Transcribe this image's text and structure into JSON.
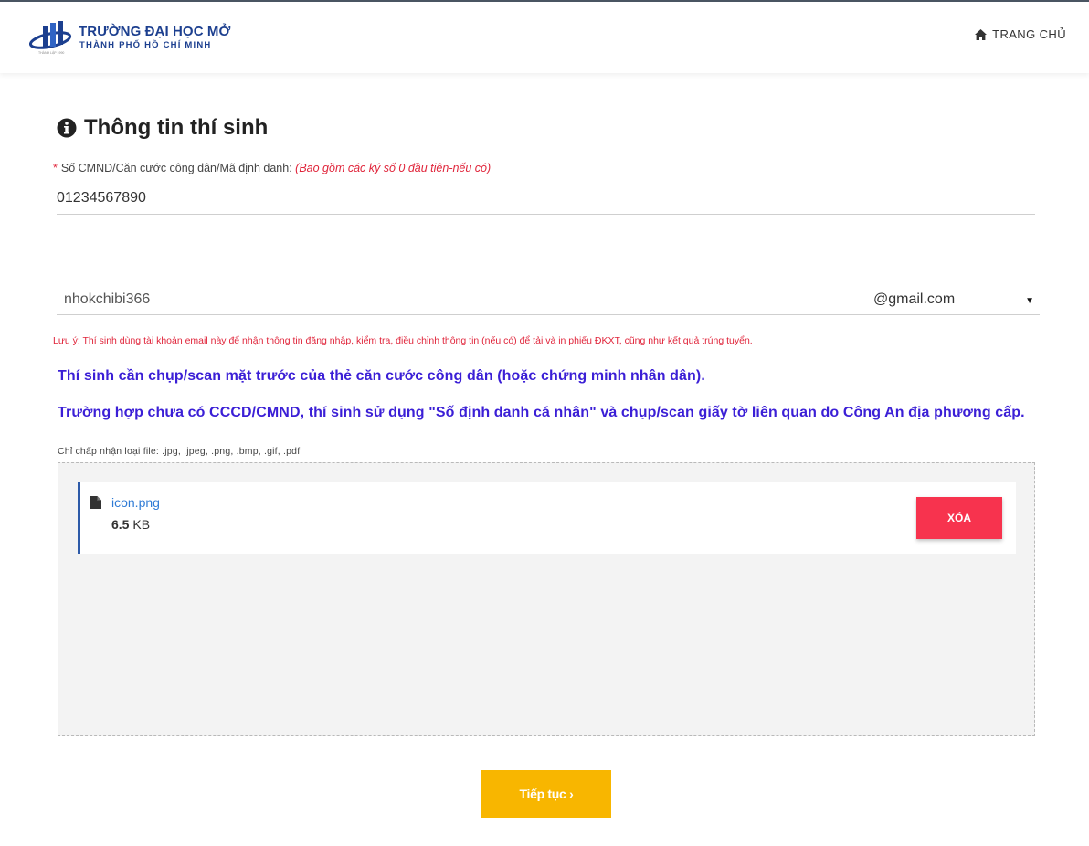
{
  "header": {
    "logo_line1": "TRƯỜNG ĐẠI HỌC MỞ",
    "logo_line2": "THÀNH PHỐ HỒ CHÍ MINH",
    "logo_small": "THÀNH LẬP 1990",
    "nav_home": "TRANG CHỦ"
  },
  "form": {
    "title": "Thông tin thí sinh",
    "id_label": {
      "required_mark": "*",
      "text": "Số CMND/Căn cước công dân/Mã định danh:",
      "hint": "(Bao gồm các ký số 0 đầu tiên-nếu có)"
    },
    "id_value": "01234567890",
    "email_user": "nhokchibi366",
    "email_domain": "@gmail.com",
    "email_note": "Lưu ý: Thí sinh dùng tài khoản email này để nhận thông tin đăng nhập, kiểm tra, điều chỉnh thông tin (nếu có) để tải và in phiếu ĐKXT, cũng như kết quả trúng tuyển.",
    "instruction1": "Thí sinh cần chụp/scan mặt trước của thẻ căn cước công dân (hoặc chứng minh nhân dân).",
    "instruction2": "Trường hợp chưa có CCCD/CMND, thí sinh sử dụng \"Số định danh cá nhân\" và chụp/scan giấy tờ liên quan do Công An địa phương cấp.",
    "accepted_types": "Chỉ chấp nhận loại file: .jpg, .jpeg, .png, .bmp, .gif, .pdf"
  },
  "upload": {
    "file_name": "icon.png",
    "file_size_value": "6.5",
    "file_size_unit": "KB",
    "delete_label": "XÓA"
  },
  "next_label": "Tiếp tục ›",
  "colors": {
    "brand_blue": "#1c3f8f",
    "instruction": "#3b1fd6",
    "error_red": "#e0243a",
    "delete_btn": "#f7334e",
    "next_btn": "#f8b600",
    "link": "#2f7bd5"
  }
}
